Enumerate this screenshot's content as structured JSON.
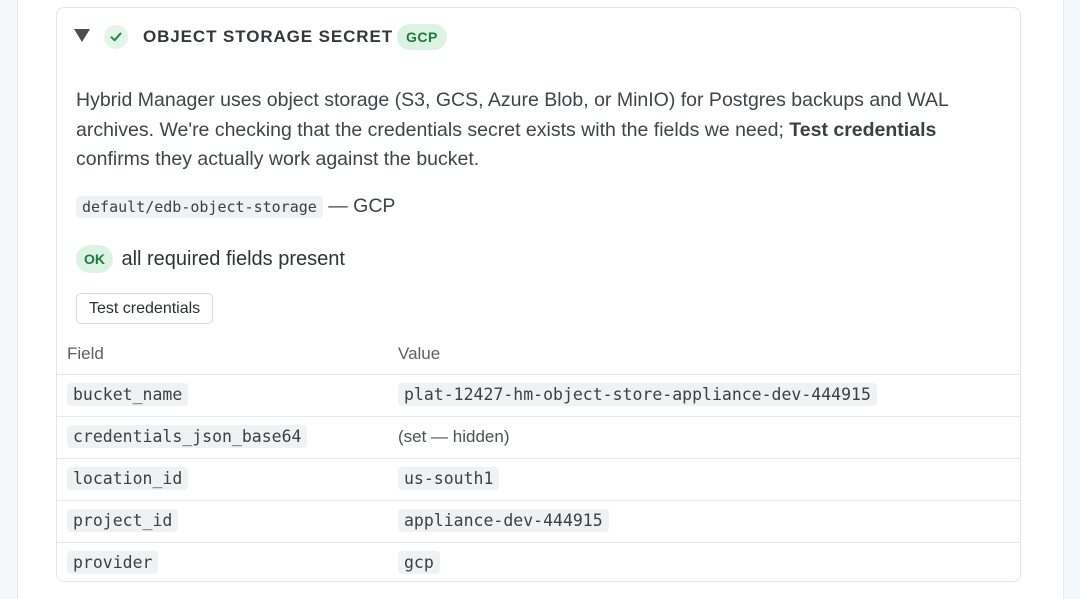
{
  "header": {
    "title": "OBJECT STORAGE SECRET",
    "provider_badge": "GCP"
  },
  "description": {
    "part1": "Hybrid Manager uses object storage (S3, GCS, Azure Blob, or MinIO) for Postgres backups and WAL archives. We're checking that the credentials secret exists with the fields we need; ",
    "bold": "Test credentials",
    "part2": " confirms they actually work against the bucket."
  },
  "secret": {
    "path": "default/edb-object-storage",
    "suffix": "— GCP"
  },
  "status": {
    "badge": "OK",
    "text": "all required fields present"
  },
  "actions": {
    "test_label": "Test credentials"
  },
  "table": {
    "headers": {
      "field": "Field",
      "value": "Value"
    },
    "rows": [
      {
        "field": "bucket_name",
        "value": "plat-12427-hm-object-store-appliance-dev-444915",
        "hidden": false
      },
      {
        "field": "credentials_json_base64",
        "value": "(set — hidden)",
        "hidden": true
      },
      {
        "field": "location_id",
        "value": "us-south1",
        "hidden": false
      },
      {
        "field": "project_id",
        "value": "appliance-dev-444915",
        "hidden": false
      },
      {
        "field": "provider",
        "value": "gcp",
        "hidden": false
      }
    ]
  },
  "colors": {
    "accent_green": "#1f7a3d",
    "badge_bg": "#dcf3e3"
  },
  "icons": {
    "toggle": "caret-down-icon",
    "status": "check-icon"
  }
}
